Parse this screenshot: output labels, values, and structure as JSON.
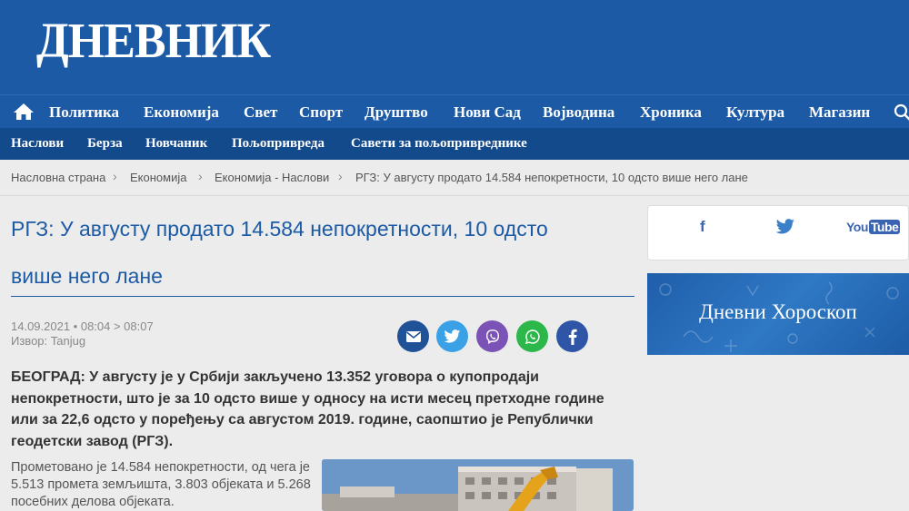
{
  "site": {
    "logo": "ДНЕВНИК"
  },
  "main_nav": [
    "Политика",
    "Економија",
    "Свет",
    "Спорт",
    "Друштво",
    "Нови Сад",
    "Војводина",
    "Хроника",
    "Култура",
    "Магазин"
  ],
  "sub_nav": [
    "Наслови",
    "Берза",
    "Новчаник",
    "Пољопривреда",
    "Савети за пољопривреднике"
  ],
  "breadcrumb": [
    "Насловна страна",
    "Економија",
    "Економија - Наслови",
    "РГЗ: У августу продато 14.584 непокретности, 10 одсто више него лане"
  ],
  "article": {
    "title_line1": "РГЗ: У августу продато 14.584 непокретности, 10 одсто",
    "title_line2": "више него лане",
    "date": "14.09.2021 • 08:04 > 08:07",
    "source": "Извор: Tanjug",
    "lead": "БЕОГРАД: У августу је у Србији закључено 13.352 уговора о купопродаји непокретности, што је за 10 одсто више у односу на исти месец претходне године или за 22,6 одсто у поређењу са августом 2019. године, саопштио је Републички геодетски завод (РГЗ).",
    "body": "Прометовано је 14.584 непокретности, од чега је 5.513 промета земљишта, 3.803 објеката и 5.268 посебних делова објеката."
  },
  "share_buttons": [
    {
      "name": "email-share-icon",
      "color": "#1f5297"
    },
    {
      "name": "twitter-share-icon",
      "color": "#3aa1e6"
    },
    {
      "name": "viber-share-icon",
      "color": "#7b52b5"
    },
    {
      "name": "whatsapp-share-icon",
      "color": "#2bb74a"
    },
    {
      "name": "facebook-share-icon",
      "color": "#2f56a6"
    }
  ],
  "sidebar": {
    "social": {
      "facebook": "f",
      "youtube_you": "You",
      "youtube_tube": "Tube"
    },
    "horoscope_label": "Дневни Хороскоп"
  },
  "colors": {
    "brand_blue": "#1c5aa5",
    "subnav_blue": "#134a8c"
  }
}
